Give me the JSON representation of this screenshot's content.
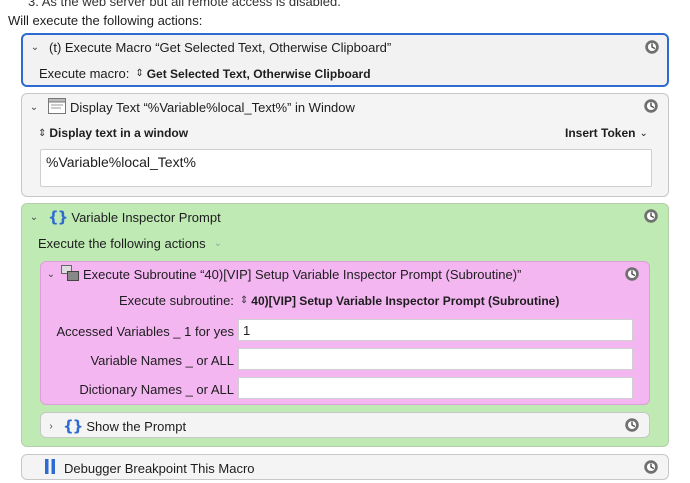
{
  "top_cut_text": "3. As the web server but all remote access is disabled.",
  "will_execute": "Will execute the following actions:",
  "actions": {
    "macro": {
      "title": "(t)  Execute Macro “Get Selected Text, Otherwise Clipboard”",
      "label": "Execute macro:",
      "value": "Get Selected Text, Otherwise Clipboard"
    },
    "display": {
      "title": "Display Text “%Variable%local_Text%” in Window",
      "mode": "Display text in a window",
      "insert_token": "Insert Token",
      "text": "%Variable%local_Text%"
    },
    "prompt": {
      "title": "Variable Inspector Prompt",
      "sub_label": "Execute the following actions",
      "subroutine": {
        "title": "Execute Subroutine “40)[VIP] Setup Variable Inspector Prompt (Subroutine)”",
        "label": "Execute subroutine:",
        "value": "40)[VIP] Setup Variable Inspector Prompt (Subroutine)",
        "fields": [
          {
            "label": "Accessed Variables _ 1 for yes",
            "value": "1"
          },
          {
            "label": "Variable Names _ or ALL",
            "value": ""
          },
          {
            "label": "Dictionary Names _ or ALL",
            "value": ""
          }
        ]
      },
      "show": {
        "title": "Show the Prompt"
      }
    },
    "breakpoint": {
      "title": "Debugger Breakpoint This Macro"
    }
  },
  "colors": {
    "selection": "#2d6ad1",
    "group_green": "#bfeab3",
    "subroutine_pink": "#f3b6f0"
  }
}
